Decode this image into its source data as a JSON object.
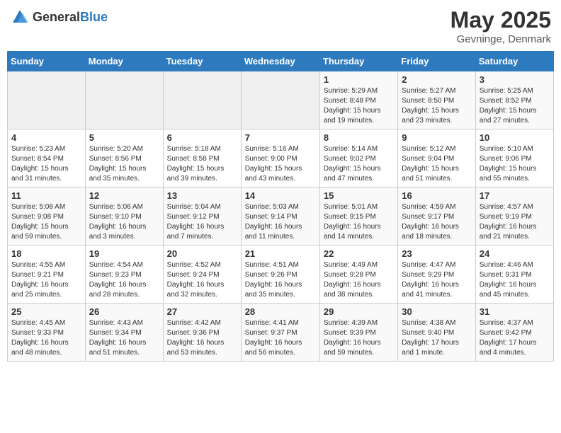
{
  "header": {
    "logo_general": "General",
    "logo_blue": "Blue",
    "month_title": "May 2025",
    "location": "Gevninge, Denmark"
  },
  "weekdays": [
    "Sunday",
    "Monday",
    "Tuesday",
    "Wednesday",
    "Thursday",
    "Friday",
    "Saturday"
  ],
  "weeks": [
    [
      {
        "day": "",
        "info": ""
      },
      {
        "day": "",
        "info": ""
      },
      {
        "day": "",
        "info": ""
      },
      {
        "day": "",
        "info": ""
      },
      {
        "day": "1",
        "info": "Sunrise: 5:29 AM\nSunset: 8:48 PM\nDaylight: 15 hours\nand 19 minutes."
      },
      {
        "day": "2",
        "info": "Sunrise: 5:27 AM\nSunset: 8:50 PM\nDaylight: 15 hours\nand 23 minutes."
      },
      {
        "day": "3",
        "info": "Sunrise: 5:25 AM\nSunset: 8:52 PM\nDaylight: 15 hours\nand 27 minutes."
      }
    ],
    [
      {
        "day": "4",
        "info": "Sunrise: 5:23 AM\nSunset: 8:54 PM\nDaylight: 15 hours\nand 31 minutes."
      },
      {
        "day": "5",
        "info": "Sunrise: 5:20 AM\nSunset: 8:56 PM\nDaylight: 15 hours\nand 35 minutes."
      },
      {
        "day": "6",
        "info": "Sunrise: 5:18 AM\nSunset: 8:58 PM\nDaylight: 15 hours\nand 39 minutes."
      },
      {
        "day": "7",
        "info": "Sunrise: 5:16 AM\nSunset: 9:00 PM\nDaylight: 15 hours\nand 43 minutes."
      },
      {
        "day": "8",
        "info": "Sunrise: 5:14 AM\nSunset: 9:02 PM\nDaylight: 15 hours\nand 47 minutes."
      },
      {
        "day": "9",
        "info": "Sunrise: 5:12 AM\nSunset: 9:04 PM\nDaylight: 15 hours\nand 51 minutes."
      },
      {
        "day": "10",
        "info": "Sunrise: 5:10 AM\nSunset: 9:06 PM\nDaylight: 15 hours\nand 55 minutes."
      }
    ],
    [
      {
        "day": "11",
        "info": "Sunrise: 5:08 AM\nSunset: 9:08 PM\nDaylight: 15 hours\nand 59 minutes."
      },
      {
        "day": "12",
        "info": "Sunrise: 5:06 AM\nSunset: 9:10 PM\nDaylight: 16 hours\nand 3 minutes."
      },
      {
        "day": "13",
        "info": "Sunrise: 5:04 AM\nSunset: 9:12 PM\nDaylight: 16 hours\nand 7 minutes."
      },
      {
        "day": "14",
        "info": "Sunrise: 5:03 AM\nSunset: 9:14 PM\nDaylight: 16 hours\nand 11 minutes."
      },
      {
        "day": "15",
        "info": "Sunrise: 5:01 AM\nSunset: 9:15 PM\nDaylight: 16 hours\nand 14 minutes."
      },
      {
        "day": "16",
        "info": "Sunrise: 4:59 AM\nSunset: 9:17 PM\nDaylight: 16 hours\nand 18 minutes."
      },
      {
        "day": "17",
        "info": "Sunrise: 4:57 AM\nSunset: 9:19 PM\nDaylight: 16 hours\nand 21 minutes."
      }
    ],
    [
      {
        "day": "18",
        "info": "Sunrise: 4:55 AM\nSunset: 9:21 PM\nDaylight: 16 hours\nand 25 minutes."
      },
      {
        "day": "19",
        "info": "Sunrise: 4:54 AM\nSunset: 9:23 PM\nDaylight: 16 hours\nand 28 minutes."
      },
      {
        "day": "20",
        "info": "Sunrise: 4:52 AM\nSunset: 9:24 PM\nDaylight: 16 hours\nand 32 minutes."
      },
      {
        "day": "21",
        "info": "Sunrise: 4:51 AM\nSunset: 9:26 PM\nDaylight: 16 hours\nand 35 minutes."
      },
      {
        "day": "22",
        "info": "Sunrise: 4:49 AM\nSunset: 9:28 PM\nDaylight: 16 hours\nand 38 minutes."
      },
      {
        "day": "23",
        "info": "Sunrise: 4:47 AM\nSunset: 9:29 PM\nDaylight: 16 hours\nand 41 minutes."
      },
      {
        "day": "24",
        "info": "Sunrise: 4:46 AM\nSunset: 9:31 PM\nDaylight: 16 hours\nand 45 minutes."
      }
    ],
    [
      {
        "day": "25",
        "info": "Sunrise: 4:45 AM\nSunset: 9:33 PM\nDaylight: 16 hours\nand 48 minutes."
      },
      {
        "day": "26",
        "info": "Sunrise: 4:43 AM\nSunset: 9:34 PM\nDaylight: 16 hours\nand 51 minutes."
      },
      {
        "day": "27",
        "info": "Sunrise: 4:42 AM\nSunset: 9:36 PM\nDaylight: 16 hours\nand 53 minutes."
      },
      {
        "day": "28",
        "info": "Sunrise: 4:41 AM\nSunset: 9:37 PM\nDaylight: 16 hours\nand 56 minutes."
      },
      {
        "day": "29",
        "info": "Sunrise: 4:39 AM\nSunset: 9:39 PM\nDaylight: 16 hours\nand 59 minutes."
      },
      {
        "day": "30",
        "info": "Sunrise: 4:38 AM\nSunset: 9:40 PM\nDaylight: 17 hours\nand 1 minute."
      },
      {
        "day": "31",
        "info": "Sunrise: 4:37 AM\nSunset: 9:42 PM\nDaylight: 17 hours\nand 4 minutes."
      }
    ]
  ]
}
